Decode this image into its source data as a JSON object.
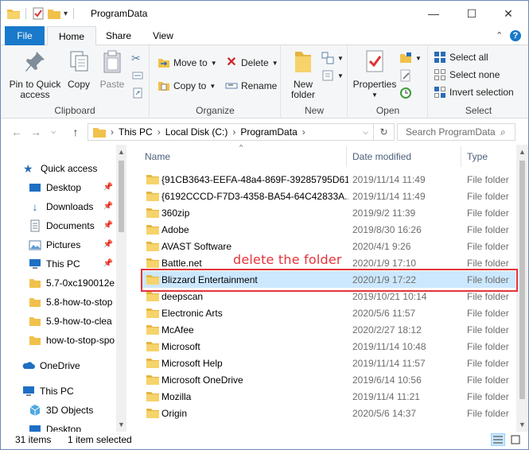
{
  "window": {
    "title": "ProgramData"
  },
  "tabs": [
    {
      "label": "File"
    },
    {
      "label": "Home"
    },
    {
      "label": "Share"
    },
    {
      "label": "View"
    }
  ],
  "ribbon": {
    "clipboard": {
      "label": "Clipboard",
      "pin_label_1": "Pin to Quick",
      "pin_label_2": "access",
      "copy_label": "Copy",
      "paste_label": "Paste"
    },
    "organize": {
      "label": "Organize",
      "move_to": "Move to",
      "copy_to": "Copy to",
      "delete": "Delete",
      "rename": "Rename"
    },
    "new": {
      "label": "New",
      "new_folder_1": "New",
      "new_folder_2": "folder"
    },
    "open": {
      "label": "Open",
      "properties": "Properties"
    },
    "select": {
      "label": "Select",
      "select_all": "Select all",
      "select_none": "Select none",
      "invert_selection": "Invert selection"
    }
  },
  "address": {
    "crumbs": [
      "This PC",
      "Local Disk (C:)",
      "ProgramData"
    ],
    "search_placeholder": "Search ProgramData"
  },
  "navpane": {
    "quick_access": "Quick access",
    "items": [
      {
        "label": "Desktop",
        "pinned": true
      },
      {
        "label": "Downloads",
        "pinned": true
      },
      {
        "label": "Documents",
        "pinned": true
      },
      {
        "label": "Pictures",
        "pinned": true
      },
      {
        "label": "This PC",
        "pinned": true
      },
      {
        "label": "5.7-0xc190012e"
      },
      {
        "label": "5.8-how-to-stop"
      },
      {
        "label": "5.9-how-to-clea"
      },
      {
        "label": "how-to-stop-spo"
      }
    ],
    "onedrive": "OneDrive",
    "thispc": "This PC",
    "objects3d": "3D Objects",
    "desktop2": "Desktop"
  },
  "columns": {
    "name": "Name",
    "date": "Date modified",
    "type": "Type"
  },
  "files": [
    {
      "name": "{91CB3643-EEFA-48a4-869F-39285795D61...",
      "date": "2019/11/14 11:49",
      "type": "File folder"
    },
    {
      "name": "{6192CCCD-F7D3-4358-BA54-64C42833A...",
      "date": "2019/11/14 11:49",
      "type": "File folder"
    },
    {
      "name": "360zip",
      "date": "2019/9/2 11:39",
      "type": "File folder"
    },
    {
      "name": "Adobe",
      "date": "2019/8/30 16:26",
      "type": "File folder"
    },
    {
      "name": "AVAST Software",
      "date": "2020/4/1 9:26",
      "type": "File folder"
    },
    {
      "name": "Battle.net",
      "date": "2020/1/9 17:10",
      "type": "File folder"
    },
    {
      "name": "Blizzard Entertainment",
      "date": "2020/1/9 17:22",
      "type": "File folder"
    },
    {
      "name": "deepscan",
      "date": "2019/10/21 10:14",
      "type": "File folder"
    },
    {
      "name": "Electronic Arts",
      "date": "2020/5/6 11:57",
      "type": "File folder"
    },
    {
      "name": "McAfee",
      "date": "2020/2/27 18:12",
      "type": "File folder"
    },
    {
      "name": "Microsoft",
      "date": "2019/11/14 10:48",
      "type": "File folder"
    },
    {
      "name": "Microsoft Help",
      "date": "2019/11/14 11:57",
      "type": "File folder"
    },
    {
      "name": "Microsoft OneDrive",
      "date": "2019/6/14 10:56",
      "type": "File folder"
    },
    {
      "name": "Mozilla",
      "date": "2019/11/4 11:21",
      "type": "File folder"
    },
    {
      "name": "Origin",
      "date": "2020/5/6 14:37",
      "type": "File folder"
    }
  ],
  "annotation": {
    "text": "delete the folder"
  },
  "status": {
    "count": "31 items",
    "selected": "1 item selected"
  },
  "colors": {
    "file_tab": "#1979ca",
    "selection": "#cce8ff",
    "annotation": "#e5333b",
    "folder": "#f0c14b"
  }
}
